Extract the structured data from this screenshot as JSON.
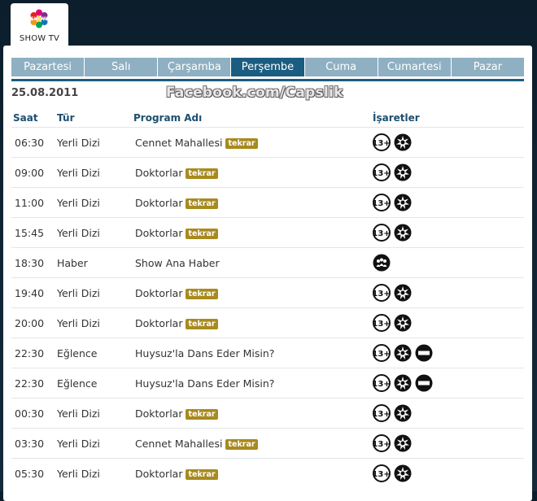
{
  "channel": {
    "name": "SHOW TV"
  },
  "days": [
    "Pazartesi",
    "Salı",
    "Çarşamba",
    "Perşembe",
    "Cuma",
    "Cumartesi",
    "Pazar"
  ],
  "active_day": "Perşembe",
  "date": "25.08.2011",
  "watermark": "Facebook.com/Capslik",
  "columns": {
    "time": "Saat",
    "genre": "Tür",
    "program": "Program Adı",
    "signs": "İşaretler"
  },
  "tag_label": "tekrar",
  "colors": {
    "active_tab": "#1b5d80",
    "inactive_tab": "#8fb0c2",
    "tag": "#a88a1e",
    "header_text": "#1b4f6e"
  },
  "rows": [
    {
      "time": "06:30",
      "genre": "Yerli Dizi",
      "program": "Cennet Mahallesi",
      "tag": "tekrar",
      "icons": [
        "age-13-icon",
        "violence-icon"
      ]
    },
    {
      "time": "09:00",
      "genre": "Yerli Dizi",
      "program": "Doktorlar",
      "tag": "tekrar",
      "icons": [
        "age-13-icon",
        "violence-icon"
      ]
    },
    {
      "time": "11:00",
      "genre": "Yerli Dizi",
      "program": "Doktorlar",
      "tag": "tekrar",
      "icons": [
        "age-13-icon",
        "violence-icon"
      ]
    },
    {
      "time": "15:45",
      "genre": "Yerli Dizi",
      "program": "Doktorlar",
      "tag": "tekrar",
      "icons": [
        "age-13-icon",
        "violence-icon"
      ]
    },
    {
      "time": "18:30",
      "genre": "Haber",
      "program": "Show Ana Haber",
      "tag": "",
      "icons": [
        "general-audience-icon"
      ]
    },
    {
      "time": "19:40",
      "genre": "Yerli Dizi",
      "program": "Doktorlar",
      "tag": "tekrar",
      "icons": [
        "age-13-icon",
        "violence-icon"
      ]
    },
    {
      "time": "20:00",
      "genre": "Yerli Dizi",
      "program": "Doktorlar",
      "tag": "tekrar",
      "icons": [
        "age-13-icon",
        "violence-icon"
      ]
    },
    {
      "time": "22:30",
      "genre": "Eğlence",
      "program": "Huysuz'la Dans Eder Misin?",
      "tag": "",
      "icons": [
        "age-13-icon",
        "violence-icon",
        "negative-example-icon"
      ]
    },
    {
      "time": "22:30",
      "genre": "Eğlence",
      "program": "Huysuz'la Dans Eder Misin?",
      "tag": "",
      "icons": [
        "age-13-icon",
        "violence-icon",
        "negative-example-icon"
      ]
    },
    {
      "time": "00:30",
      "genre": "Yerli Dizi",
      "program": "Doktorlar",
      "tag": "tekrar",
      "icons": [
        "age-13-icon",
        "violence-icon"
      ]
    },
    {
      "time": "03:30",
      "genre": "Yerli Dizi",
      "program": "Cennet Mahallesi",
      "tag": "tekrar",
      "icons": [
        "age-13-icon",
        "violence-icon"
      ]
    },
    {
      "time": "05:30",
      "genre": "Yerli Dizi",
      "program": "Doktorlar",
      "tag": "tekrar",
      "icons": [
        "age-13-icon",
        "violence-icon"
      ]
    }
  ]
}
